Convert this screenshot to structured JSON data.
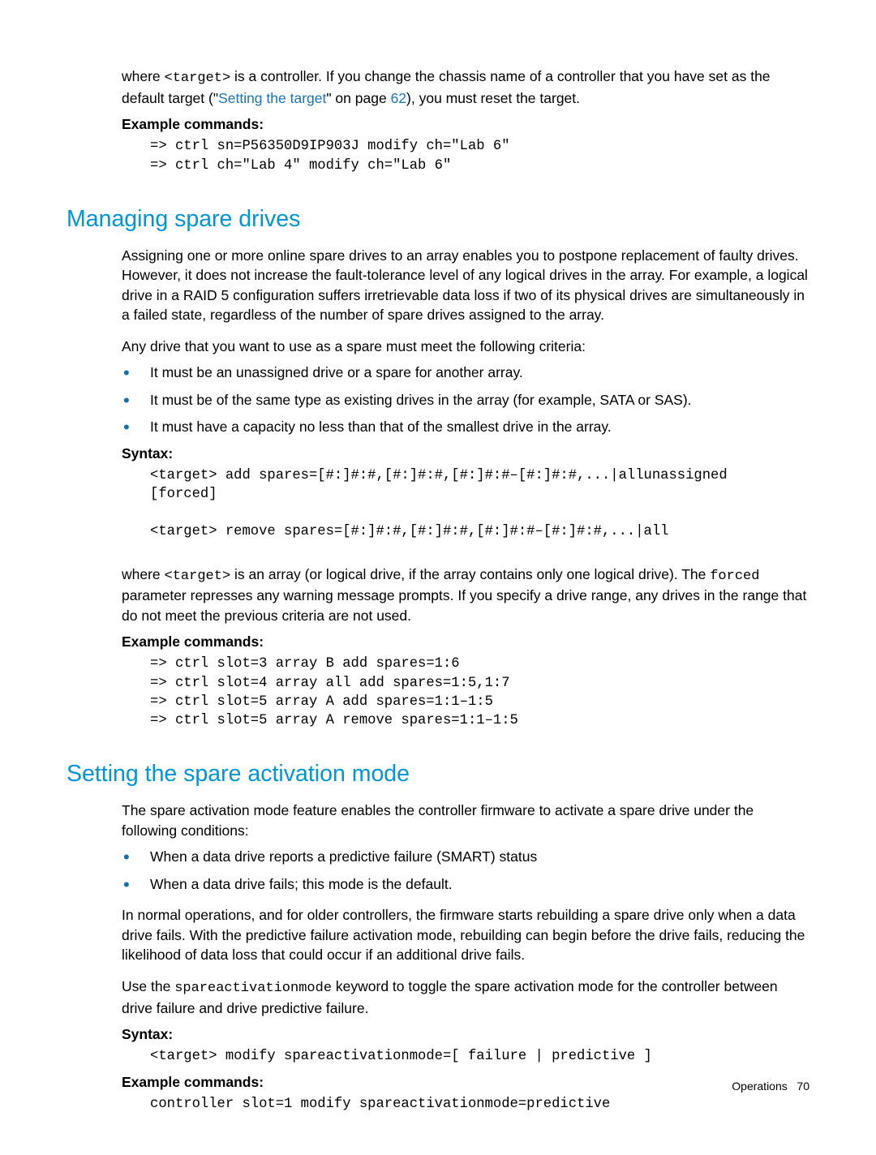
{
  "intro": {
    "where_prefix": "where ",
    "target_mono": "<target>",
    "where_rest": " is a controller. If you change the chassis name of a controller that you have set as the default target (\"",
    "link_text": "Setting the target",
    "where_mid": "\" on page ",
    "page_num": "62",
    "where_end": "), you must reset the target."
  },
  "ex1": {
    "label": "Example commands:",
    "code": "=> ctrl sn=P56350D9IP903J modify ch=\"Lab 6\"\n=> ctrl ch=\"Lab 4\" modify ch=\"Lab 6\""
  },
  "h_spare": "Managing spare drives",
  "spare_p1": "Assigning one or more online spare drives to an array enables you to postpone replacement of faulty drives. However, it does not increase the fault-tolerance level of any logical drives in the array. For example, a logical drive in a RAID 5 configuration suffers irretrievable data loss if two of its physical drives are simultaneously in a failed state, regardless of the number of spare drives assigned to the array.",
  "spare_p2": "Any drive that you want to use as a spare must meet the following criteria:",
  "spare_bullets": [
    "It must be an unassigned drive or a spare for another array.",
    "It must be of the same type as existing drives in the array (for example, SATA or SAS).",
    "It must have a capacity no less than that of the smallest drive in the array."
  ],
  "syntax1": {
    "label": "Syntax:",
    "code": "<target> add spares=[#:]#:#,[#:]#:#,[#:]#:#–[#:]#:#,...|allunassigned\n[forced]\n\n<target> remove spares=[#:]#:#,[#:]#:#,[#:]#:#–[#:]#:#,...|all"
  },
  "spare_p3_a": "where ",
  "spare_p3_target": "<target>",
  "spare_p3_b": " is an array (or logical drive, if the array contains only one logical drive). The ",
  "spare_p3_forced": "forced",
  "spare_p3_c": " parameter represses any warning message prompts. If you specify a drive range, any drives in the range that do not meet the previous criteria are not used.",
  "ex2": {
    "label": "Example commands:",
    "code": "=> ctrl slot=3 array B add spares=1:6\n=> ctrl slot=4 array all add spares=1:5,1:7\n=> ctrl slot=5 array A add spares=1:1–1:5\n=> ctrl slot=5 array A remove spares=1:1–1:5"
  },
  "h_mode": "Setting the spare activation mode",
  "mode_p1": "The spare activation mode feature enables the controller firmware to activate a spare drive under the following conditions:",
  "mode_bullets": [
    "When a data drive reports a predictive failure (SMART) status",
    "When a data drive fails; this mode is the default."
  ],
  "mode_p2": "In normal operations, and for older controllers, the firmware starts rebuilding a spare drive only when a data drive fails. With the predictive failure activation mode, rebuilding can begin before the drive fails, reducing the likelihood of data loss that could occur if an additional drive fails.",
  "mode_p3_a": "Use the ",
  "mode_p3_kw": "spareactivationmode",
  "mode_p3_b": " keyword to toggle the spare activation mode for the controller between drive failure and drive predictive failure.",
  "syntax2": {
    "label": "Syntax:",
    "code": "<target> modify spareactivationmode=[ failure | predictive ]"
  },
  "ex3": {
    "label": "Example commands:",
    "code": "controller slot=1 modify spareactivationmode=predictive"
  },
  "footer": {
    "section": "Operations",
    "page": "70"
  }
}
